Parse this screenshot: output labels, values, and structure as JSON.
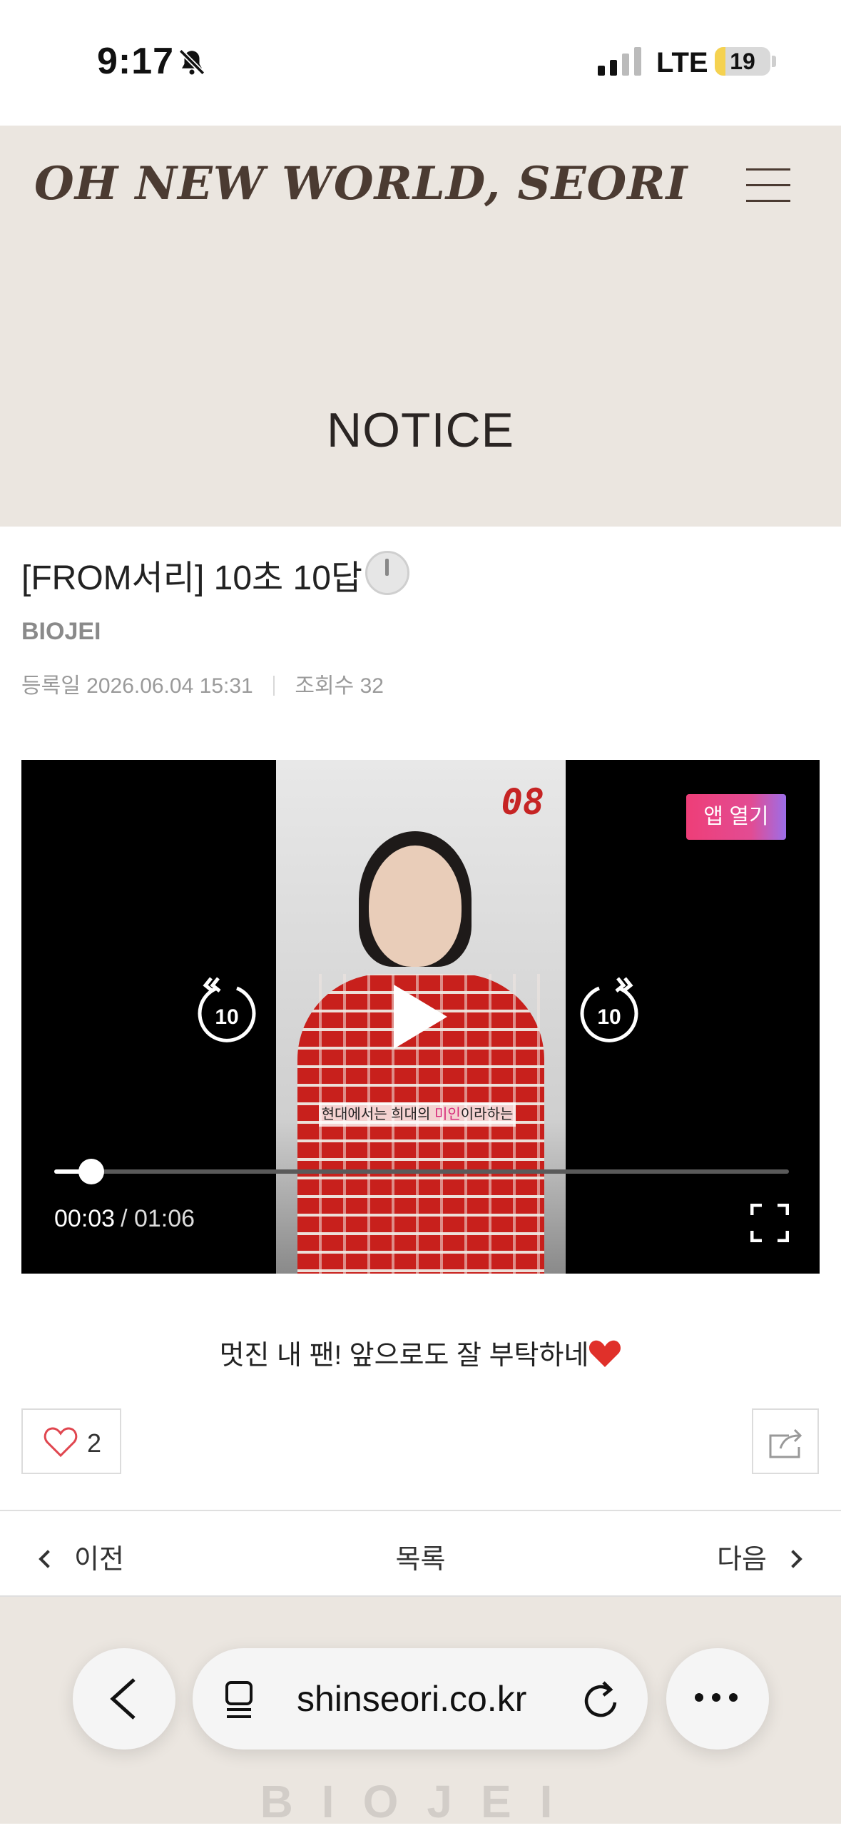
{
  "status_bar": {
    "time": "9:17",
    "carrier": "LTE",
    "battery": "19",
    "battery_level": 0.19
  },
  "header": {
    "brand": "OH NEW WORLD, SEORI",
    "menu_icon": "hamburger-menu-icon",
    "section_title": "NOTICE",
    "background": "#ebe6e0"
  },
  "post": {
    "title": "[FROM서리] 10초 10답",
    "author": "BIOJEI",
    "date_label": "등록일",
    "date": "2026.06.04 15:31",
    "views_label": "조회수",
    "views": "32"
  },
  "video": {
    "open_app_label": "앱 열기",
    "frame_counter": "08",
    "subtitle_before": "현대에서는 희대의 ",
    "subtitle_highlight": "미인",
    "subtitle_after": "이라하는",
    "rewind_seconds": "10",
    "forward_seconds": "10",
    "current_time": "00:03",
    "duration": "/ 01:06",
    "progress_fraction": 0.05
  },
  "caption": "멋진 내 팬! 앞으로도 잘 부탁하네",
  "actions": {
    "like_count": "2",
    "like_icon": "heart-outline-icon",
    "share_icon": "share-icon",
    "accent": "#e0464f"
  },
  "pager": {
    "prev": "이전",
    "list": "목록",
    "next": "다음"
  },
  "footer": {
    "logo": "BIOJEI"
  },
  "browser": {
    "url": "shinseori.co.kr"
  }
}
